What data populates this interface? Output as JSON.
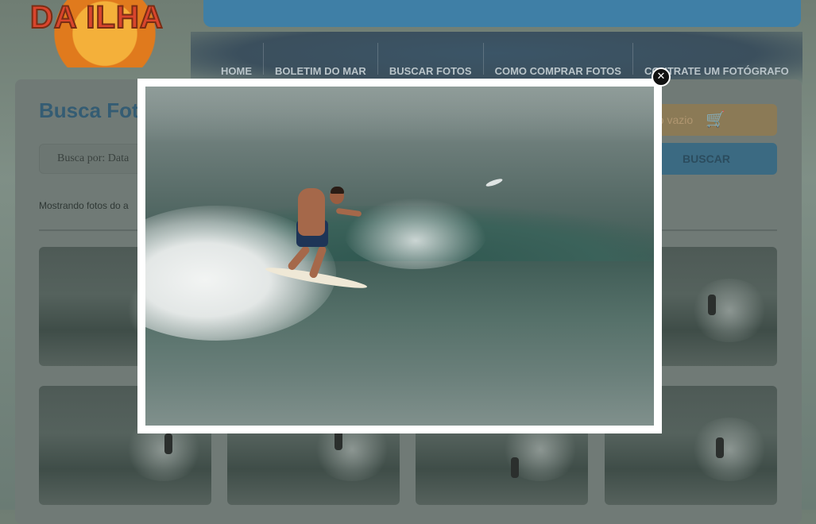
{
  "site": {
    "logo_text": "DA ILHA"
  },
  "nav": {
    "items": [
      "HOME",
      "BOLETIM DO MAR",
      "BUSCAR FOTOS",
      "COMO COMPRAR FOTOS",
      "CONTRATE UM FOTÓGRAFO"
    ]
  },
  "main": {
    "title": "Busca Foto",
    "search_placeholder": "Busca por: Data",
    "cart_label": "no vazio",
    "search_button": "BUSCAR",
    "showing_text": "Mostrando fotos do a"
  },
  "lightbox": {
    "close_icon": "close-icon"
  },
  "icons": {
    "cart": "cart-icon"
  },
  "colors": {
    "accent_blue": "#3f7fa6",
    "cart_orange": "#e9b676",
    "title_blue": "#4f8fb3"
  }
}
